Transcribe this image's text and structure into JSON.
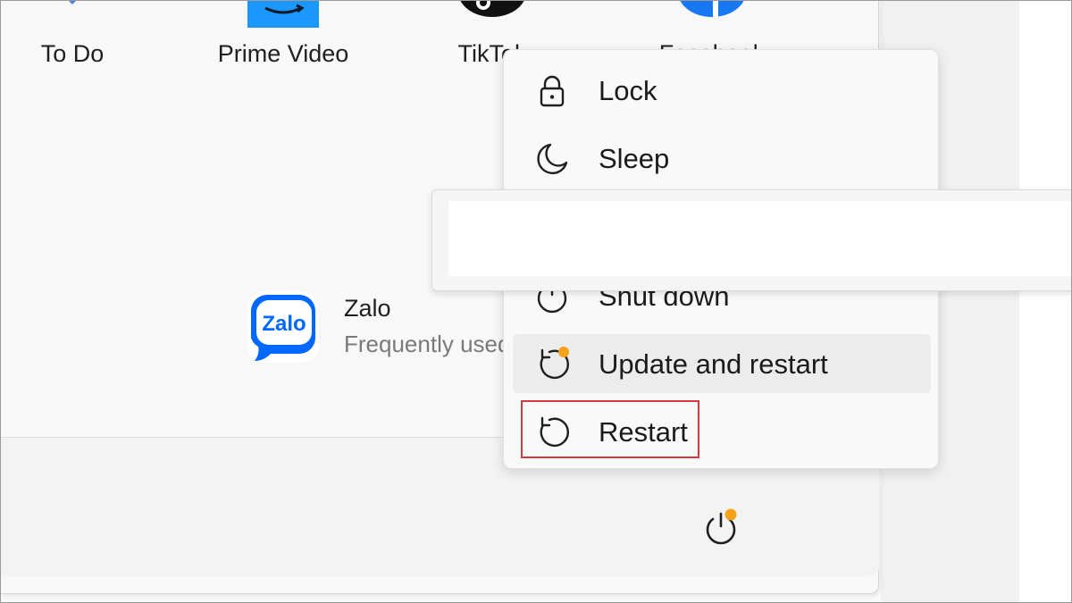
{
  "pinned_apps": [
    {
      "label": "To Do",
      "icon": "todo-icon"
    },
    {
      "label": "Prime Video",
      "icon": "prime-video-icon"
    },
    {
      "label": "TikTok",
      "icon": "tiktok-icon"
    },
    {
      "label": "Facebook",
      "icon": "facebook-icon"
    }
  ],
  "recommended": {
    "name": "Zalo",
    "subtitle": "Frequently used",
    "icon_text": "Zalo",
    "icon": "zalo-icon"
  },
  "power_menu": {
    "items": [
      {
        "label": "Lock",
        "icon": "lock-icon"
      },
      {
        "label": "Sleep",
        "icon": "sleep-moon-icon"
      },
      {
        "label": "Shut down",
        "icon": "shutdown-icon"
      },
      {
        "label": "Update and restart",
        "icon": "update-restart-icon"
      },
      {
        "label": "Restart",
        "icon": "restart-icon"
      }
    ],
    "hovered_item": "Update and restart",
    "highlighted_item": "Restart"
  },
  "power_button": {
    "icon": "power-icon",
    "badge": "update-badge"
  },
  "colors": {
    "accent_orange": "#f7a21b",
    "highlight_red": "#d9363e",
    "zalo_blue": "#0068ff",
    "prime_blue": "#1a98ff",
    "facebook_blue": "#1877f2",
    "todo_blue": "#4a7fe0"
  }
}
